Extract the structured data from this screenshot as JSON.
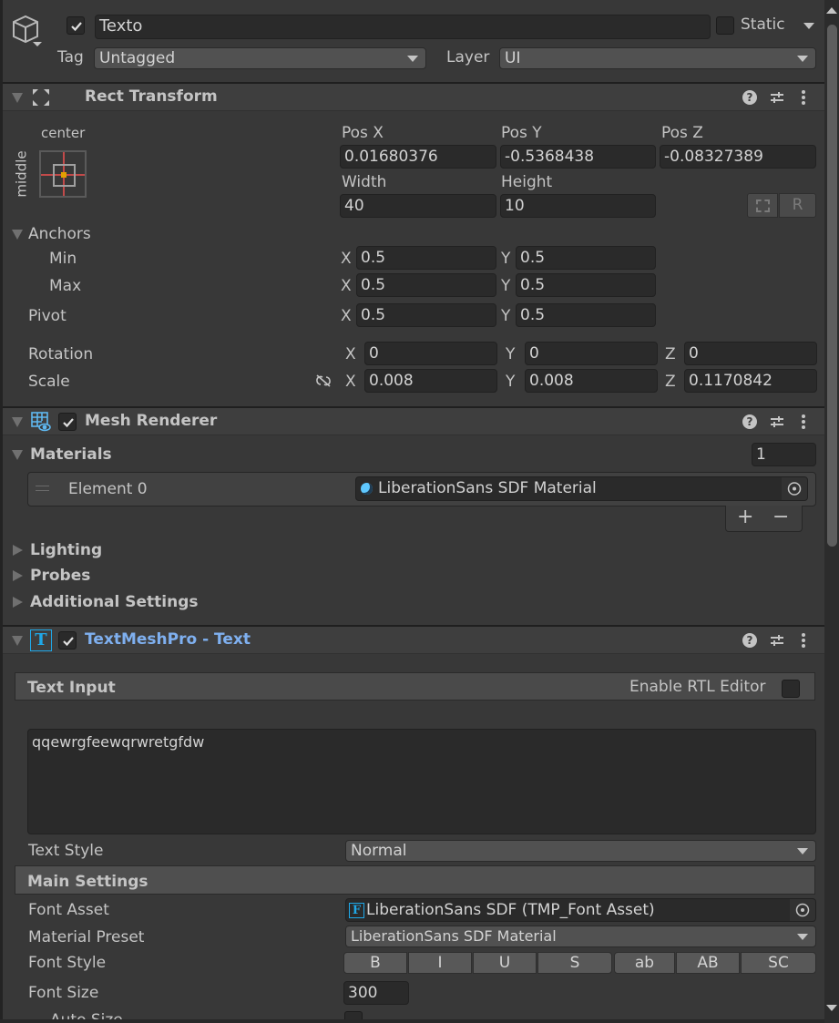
{
  "object": {
    "active": true,
    "name": "Texto",
    "static_label": "Static",
    "static": false,
    "tag_label": "Tag",
    "tag_value": "Untagged",
    "layer_label": "Layer",
    "layer_value": "UI"
  },
  "rect_transform": {
    "title": "Rect Transform",
    "anchor_preset_h": "center",
    "anchor_preset_v": "middle",
    "pos_x_label": "Pos X",
    "pos_x": "0.01680376",
    "pos_y_label": "Pos Y",
    "pos_y": "-0.5368438",
    "pos_z_label": "Pos Z",
    "pos_z": "-0.08327389",
    "width_label": "Width",
    "width": "40",
    "height_label": "Height",
    "height": "10",
    "raw_edit_label": "R",
    "anchors_label": "Anchors",
    "min_label": "Min",
    "min_x": "0.5",
    "min_y": "0.5",
    "max_label": "Max",
    "max_x": "0.5",
    "max_y": "0.5",
    "pivot_label": "Pivot",
    "pivot_x": "0.5",
    "pivot_y": "0.5",
    "rotation_label": "Rotation",
    "rot_x": "0",
    "rot_y": "0",
    "rot_z": "0",
    "scale_label": "Scale",
    "scale_x": "0.008",
    "scale_y": "0.008",
    "scale_z": "0.1170842",
    "axis_x": "X",
    "axis_y": "Y",
    "axis_z": "Z"
  },
  "mesh_renderer": {
    "title": "Mesh Renderer",
    "enabled": true,
    "materials_label": "Materials",
    "materials_count": "1",
    "element_label": "Element 0",
    "element_value": "LiberationSans SDF Material",
    "add_label": "+",
    "remove_label": "−",
    "lighting_label": "Lighting",
    "probes_label": "Probes",
    "additional_label": "Additional Settings"
  },
  "tmp": {
    "title": "TextMeshPro - Text",
    "enabled": true,
    "accent": "#7fb0f0",
    "text_input_label": "Text Input",
    "rtl_label": "Enable RTL Editor",
    "rtl": false,
    "text_value": "qqewrgfeewqrwretgfdw",
    "text_style_label": "Text Style",
    "text_style_value": "Normal",
    "main_settings_label": "Main Settings",
    "font_asset_label": "Font Asset",
    "font_asset_value": "LiberationSans SDF (TMP_Font Asset)",
    "material_preset_label": "Material Preset",
    "material_preset_value": "LiberationSans SDF Material",
    "font_style_label": "Font Style",
    "font_style_buttons": [
      "B",
      "I",
      "U",
      "S",
      "ab",
      "AB",
      "SC"
    ],
    "font_size_label": "Font Size",
    "font_size_value": "300",
    "auto_size_label": "Auto Size"
  }
}
